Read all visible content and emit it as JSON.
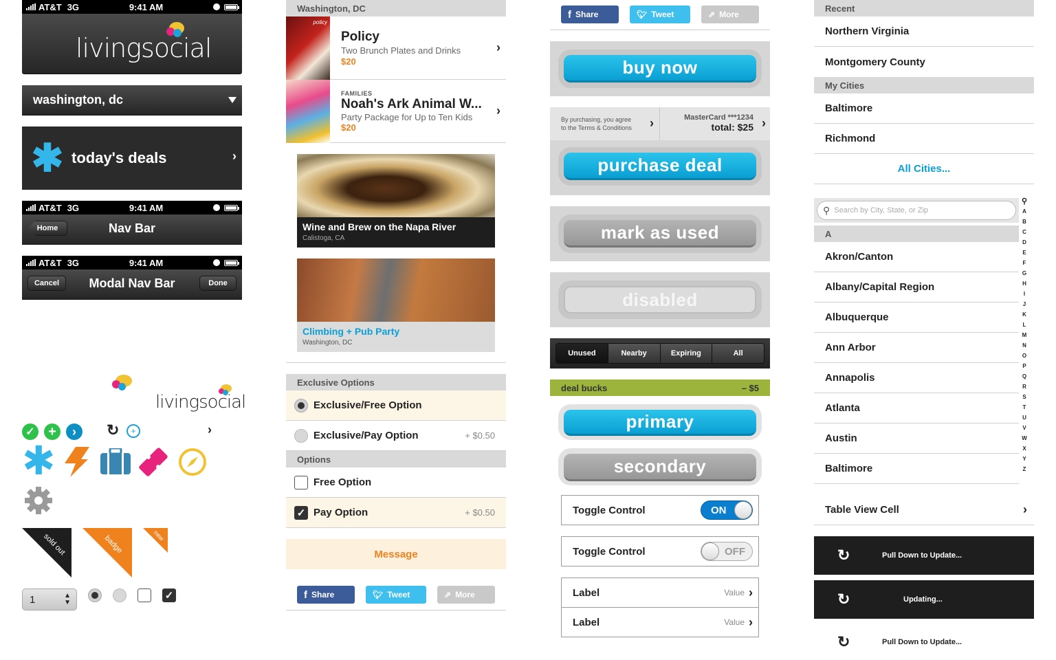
{
  "status": {
    "carrier": "AT&T",
    "network": "3G",
    "time": "9:41 AM"
  },
  "brand": {
    "logo_text": "livingsocial"
  },
  "location_bar": {
    "city": "washington, dc"
  },
  "todays_deals": {
    "label": "today's deals"
  },
  "nav_bar": {
    "back_label": "Home",
    "title": "Nav Bar"
  },
  "modal_nav_bar": {
    "cancel_label": "Cancel",
    "title": "Modal Nav Bar",
    "done_label": "Done"
  },
  "icons": [
    "check-circle-icon",
    "plus-circle-icon",
    "chevron-circle-icon",
    "refresh-icon",
    "crosshair-icon",
    "chevron-right-icon",
    "asterisk-icon",
    "lightning-icon",
    "briefcase-icon",
    "ticket-icon",
    "compass-icon",
    "gear-icon"
  ],
  "banners": {
    "sold_out": "sold out",
    "badge": "badge",
    "new": "new"
  },
  "stepper": {
    "value": "1"
  },
  "deal_list": {
    "header": "Washington, DC",
    "items": [
      {
        "category": "",
        "title": "Policy",
        "subtitle": "Two Brunch Plates and Drinks",
        "price": "$20",
        "thumb_text": "policy"
      },
      {
        "category": "FAMILIES",
        "title": "Noah's Ark Animal W...",
        "subtitle": "Party Package for Up to Ten Kids",
        "price": "$20",
        "thumb_text": ""
      }
    ]
  },
  "cards": [
    {
      "title": "Wine and Brew on the Napa River",
      "location": "Calistoga, CA"
    },
    {
      "title": "Climbing + Pub Party",
      "location": "Washington, DC"
    }
  ],
  "options": {
    "exclusive_header": "Exclusive Options",
    "exclusive_free": "Exclusive/Free Option",
    "exclusive_pay": "Exclusive/Pay Option",
    "exclusive_pay_price": "+ $0.50",
    "options_header": "Options",
    "free_option": "Free Option",
    "pay_option": "Pay Option",
    "pay_option_price": "+ $0.50",
    "message": "Message"
  },
  "share": {
    "share": "Share",
    "tweet": "Tweet",
    "more": "More"
  },
  "buttons": {
    "buy_now": "buy now",
    "terms_line1": "By purchasing, you agree",
    "terms_line2": "to the Terms & Conditions",
    "card": "MasterCard ***1234",
    "total": "total: $25",
    "purchase_deal": "purchase deal",
    "mark_as_used": "mark as used",
    "disabled": "disabled",
    "primary": "primary",
    "secondary": "secondary"
  },
  "segmented": {
    "items": [
      "Unused",
      "Nearby",
      "Expiring",
      "All"
    ],
    "selected": "Unused"
  },
  "deal_bucks": {
    "label": "deal bucks",
    "value": "– $5"
  },
  "toggles": [
    {
      "label": "Toggle Control",
      "state": "ON"
    },
    {
      "label": "Toggle Control",
      "state": "OFF"
    }
  ],
  "label_rows": [
    {
      "label": "Label",
      "value": "Value"
    },
    {
      "label": "Label",
      "value": "Value"
    }
  ],
  "cities": {
    "recent_header": "Recent",
    "recent": [
      "Northern Virginia",
      "Montgomery County"
    ],
    "my_cities_header": "My Cities",
    "my_cities": [
      "Baltimore",
      "Richmond"
    ],
    "all_cities": "All Cities...",
    "search_placeholder": "Search by City, State, or Zip",
    "index_header": "A",
    "list": [
      "Akron/Canton",
      "Albany/Capital Region",
      "Albuquerque",
      "Ann Arbor",
      "Annapolis",
      "Atlanta",
      "Austin",
      "Baltimore"
    ],
    "index_letters": [
      "A",
      "B",
      "C",
      "D",
      "E",
      "F",
      "G",
      "H",
      "I",
      "J",
      "K",
      "L",
      "M",
      "N",
      "O",
      "P",
      "Q",
      "R",
      "S",
      "T",
      "U",
      "V",
      "W",
      "X",
      "Y",
      "Z"
    ]
  },
  "table_view_cell": {
    "label": "Table View Cell"
  },
  "pull": {
    "pull_label": "Pull Down to Update...",
    "updating_label": "Updating...",
    "pull_label_light": "Pull Down to Update..."
  },
  "colors": {
    "accent_blue": "#0aa0d6",
    "orange": "#f0821e",
    "pink": "#e8237d",
    "yellow": "#f1c232",
    "green": "#2ec24a",
    "olive": "#9cb43c"
  }
}
